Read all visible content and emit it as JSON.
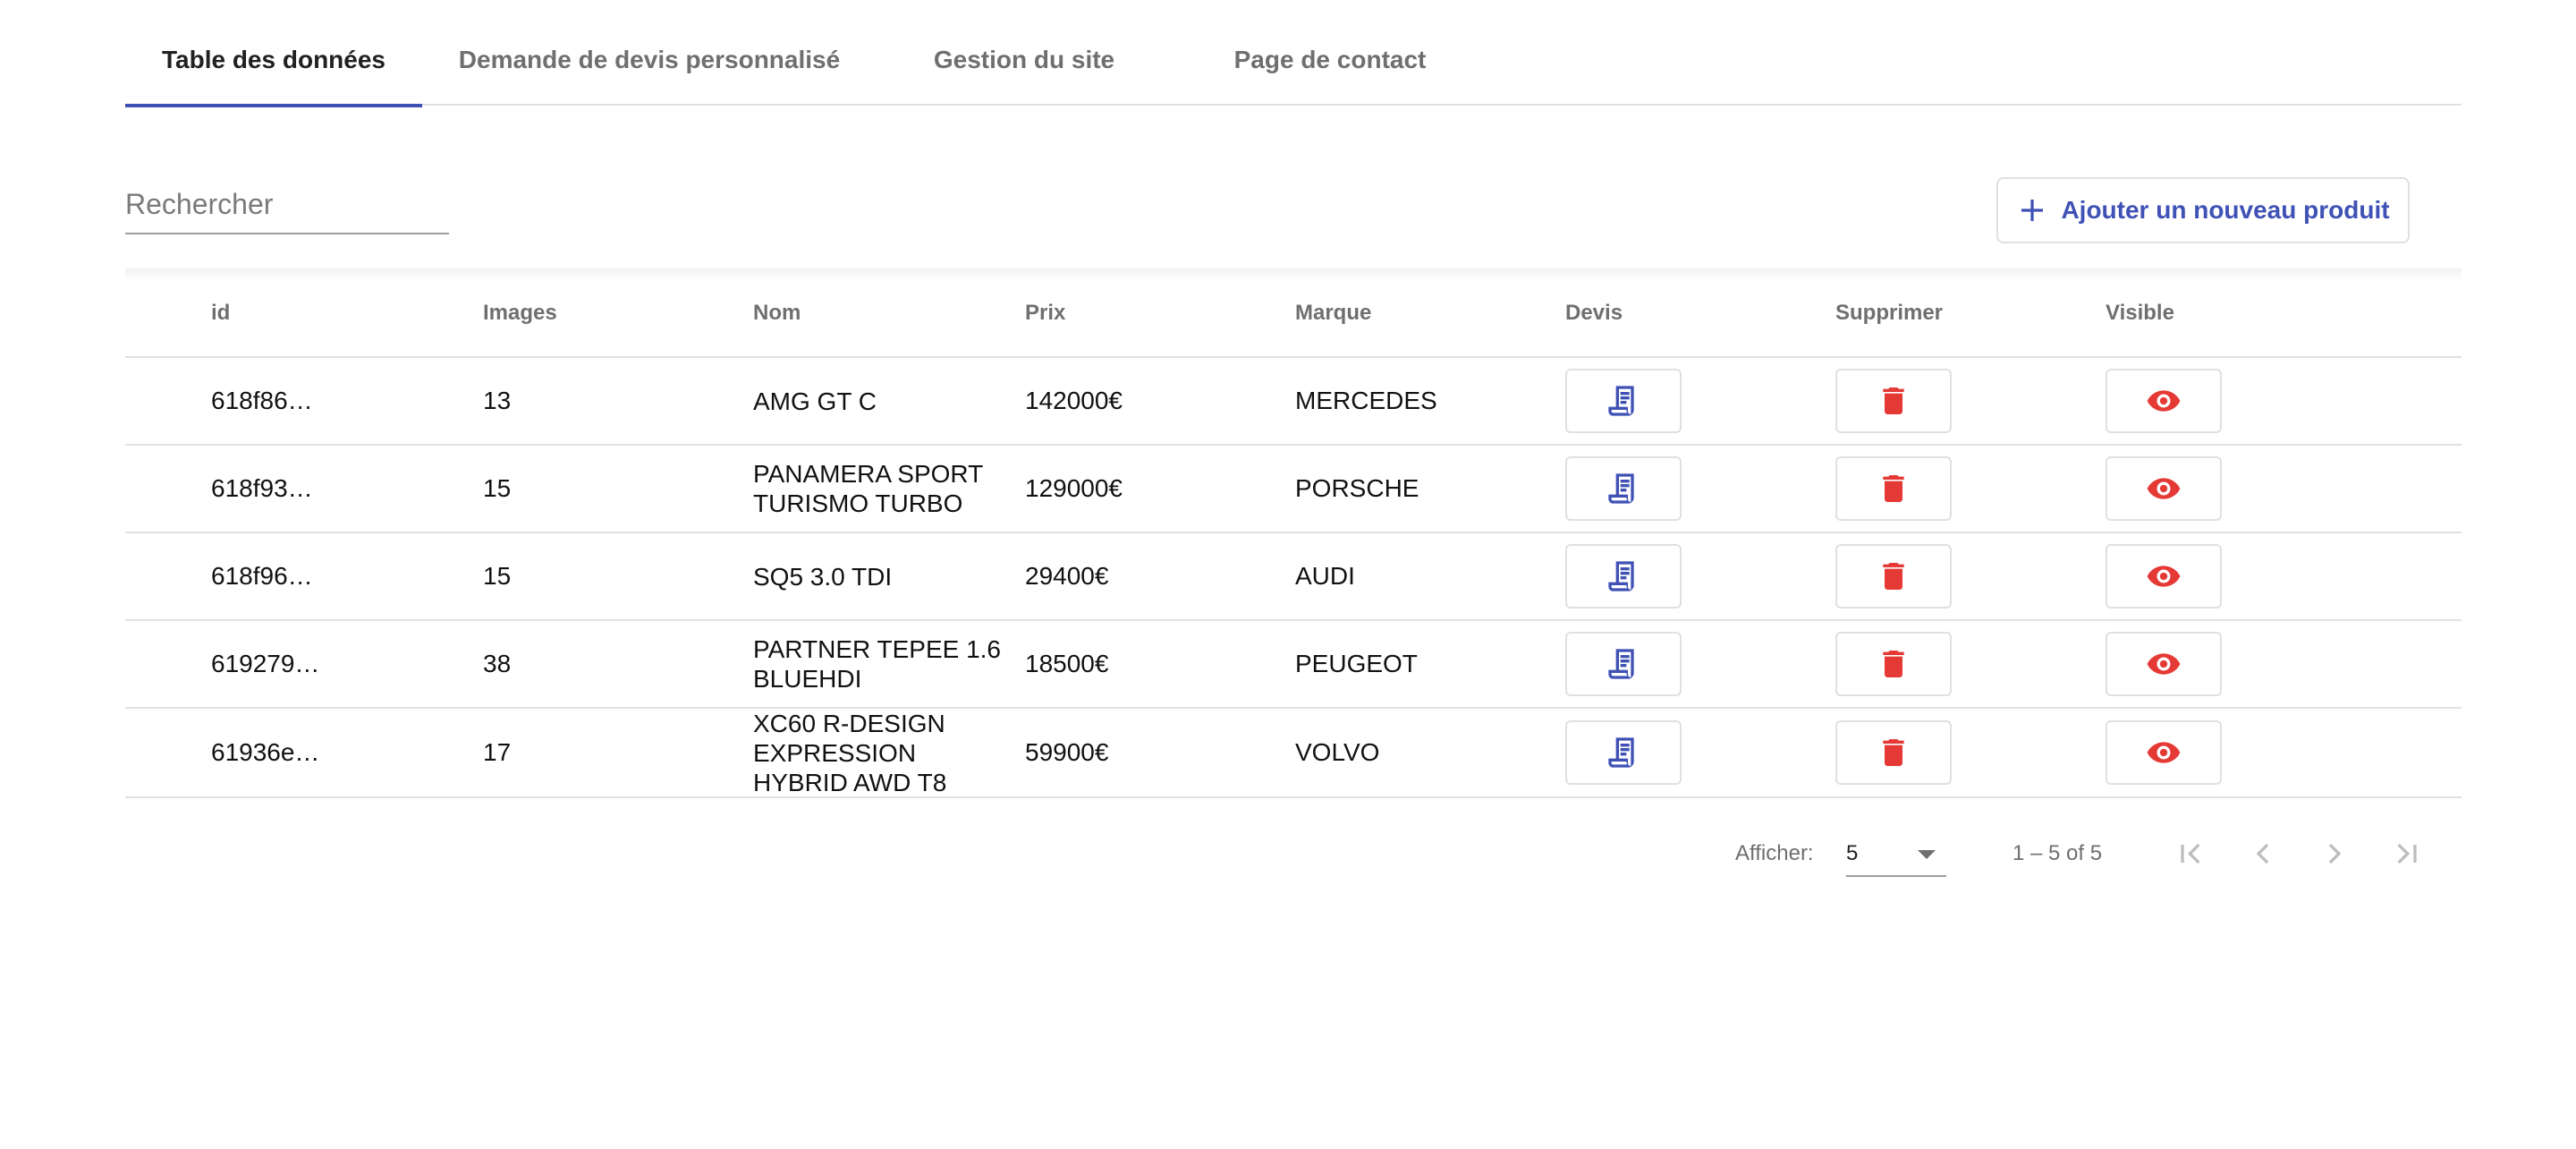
{
  "tabs": [
    {
      "label": "Table des données",
      "active": true
    },
    {
      "label": "Demande de devis personnalisé",
      "active": false
    },
    {
      "label": "Gestion du site",
      "active": false
    },
    {
      "label": "Page de contact",
      "active": false
    }
  ],
  "search": {
    "placeholder": "Rechercher",
    "value": ""
  },
  "add_button": {
    "label": "Ajouter un nouveau produit",
    "icon": "plus-icon"
  },
  "table": {
    "headers": {
      "id": "id",
      "images": "Images",
      "nom": "Nom",
      "prix": "Prix",
      "marque": "Marque",
      "devis": "Devis",
      "supprimer": "Supprimer",
      "visible": "Visible"
    },
    "rows": [
      {
        "id": "618f86…",
        "images": "13",
        "nom": "AMG GT C",
        "prix": "142000€",
        "marque": "MERCEDES"
      },
      {
        "id": "618f93…",
        "images": "15",
        "nom": "PANAMERA SPORT TURISMO TURBO",
        "prix": "129000€",
        "marque": "PORSCHE"
      },
      {
        "id": "618f96…",
        "images": "15",
        "nom": "SQ5 3.0 TDI",
        "prix": "29400€",
        "marque": "AUDI"
      },
      {
        "id": "619279…",
        "images": "38",
        "nom": "PARTNER TEPEE 1.6 BLUEHDI",
        "prix": "18500€",
        "marque": "PEUGEOT"
      },
      {
        "id": "61936e…",
        "images": "17",
        "nom": "XC60 R-DESIGN EXPRESSION HYBRID AWD T8",
        "prix": "59900€",
        "marque": "VOLVO"
      }
    ],
    "icons": {
      "devis": "receipt-icon",
      "supprimer": "trash-icon",
      "visible": "eye-icon"
    }
  },
  "paginator": {
    "label": "Afficher:",
    "page_size": "5",
    "range": "1 – 5 of 5",
    "icons": [
      "first-page-icon",
      "previous-page-icon",
      "next-page-icon",
      "last-page-icon"
    ]
  },
  "colors": {
    "accent": "#3f51b5",
    "danger": "#e53935",
    "border": "#e0e0e0",
    "muted_text": "#6f6f6f"
  }
}
